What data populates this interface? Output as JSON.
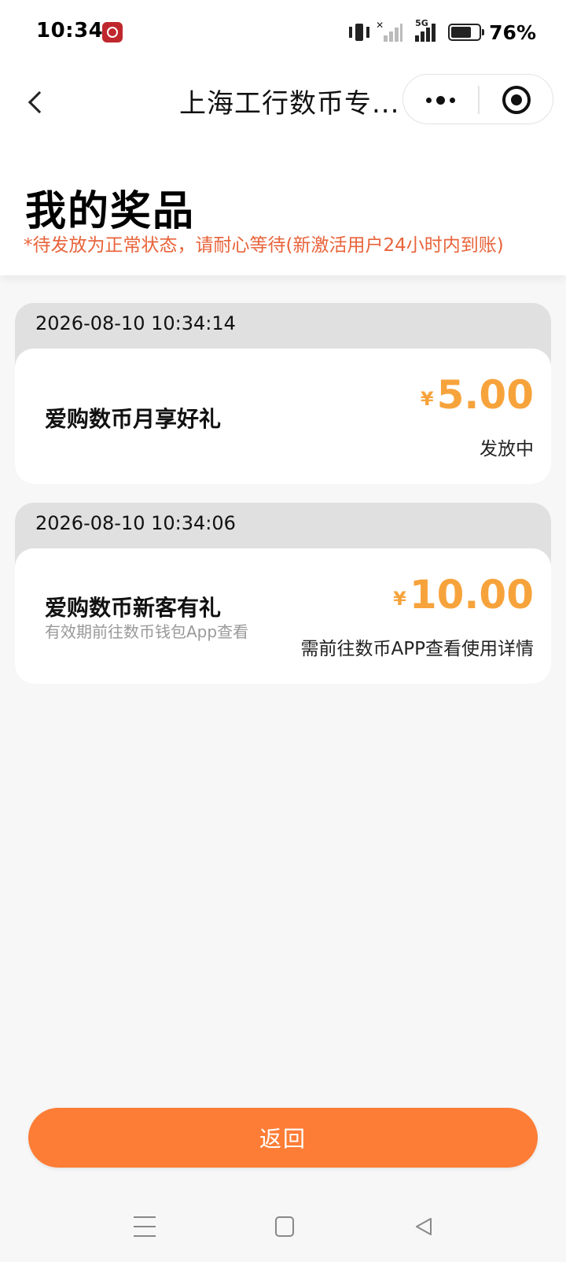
{
  "status_bar": {
    "time": "10:34",
    "network": "5G",
    "battery_level": 0.76,
    "battery_text": "76%"
  },
  "navbar": {
    "title": "上海工行数币专..."
  },
  "header": {
    "title": "我的奖品",
    "notice": "*待发放为正常状态，请耐心等待(新激活用户24小时内到账)"
  },
  "prizes": [
    {
      "time": "2026-08-10 10:34:14",
      "name": "爱购数币月享好礼",
      "subtitle": "",
      "currency": "¥",
      "amount": "5.00",
      "status": "发放中"
    },
    {
      "time": "2026-08-10 10:34:06",
      "name": "爱购数币新客有礼",
      "subtitle": "有效期前往数币钱包App查看",
      "currency": "¥",
      "amount": "10.00",
      "status": "需前往数币APP查看使用详情"
    }
  ],
  "return_button": {
    "label": "返回"
  },
  "colors": {
    "accent": "#fd7d36",
    "amount": "#f7a33c",
    "notice": "#e8633a"
  },
  "icons": [
    "back-icon",
    "more-icon",
    "close-miniprogram-icon",
    "menu-icon",
    "home-icon",
    "triangle-back-icon"
  ]
}
